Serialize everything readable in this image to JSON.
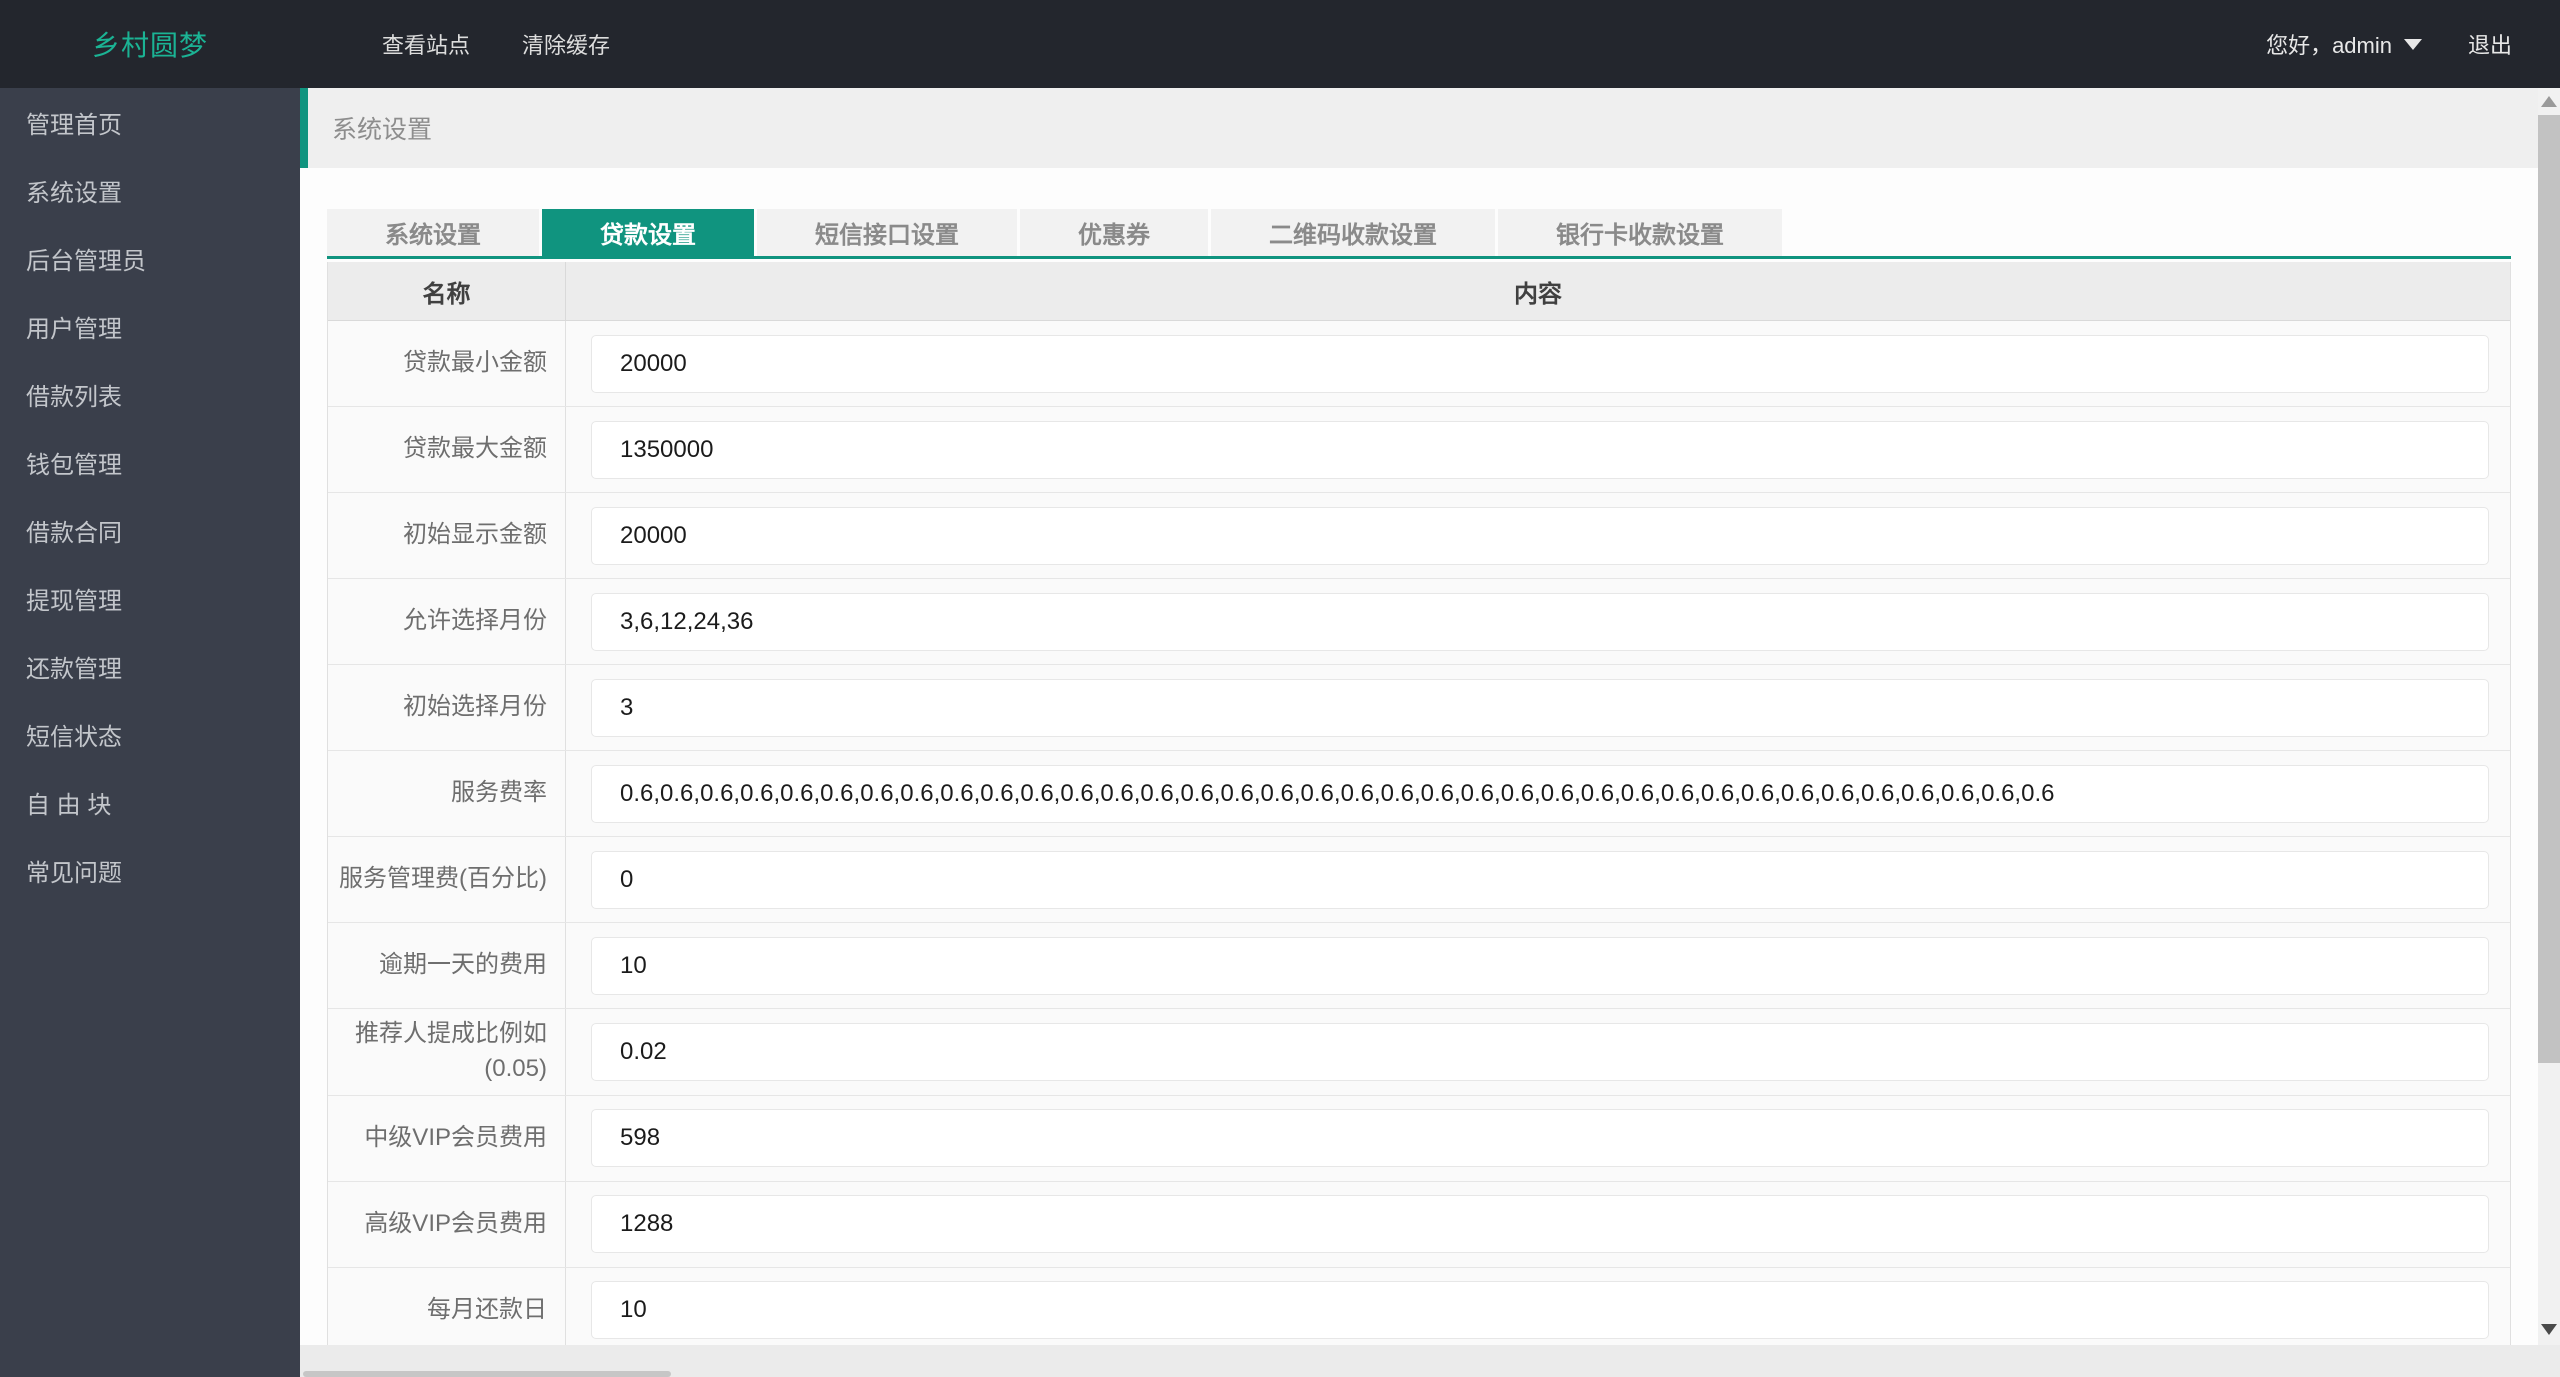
{
  "header": {
    "brand": "乡村圆梦",
    "menu": [
      {
        "label": "查看站点"
      },
      {
        "label": "清除缓存"
      }
    ],
    "greeting": "您好，admin",
    "logout_label": "退出"
  },
  "sidebar": {
    "items": [
      "管理首页",
      "系统设置",
      "后台管理员",
      "用户管理",
      "借款列表",
      "钱包管理",
      "借款合同",
      "提现管理",
      "还款管理",
      "短信状态",
      "自 由 块",
      "常见问题"
    ]
  },
  "breadcrumb": {
    "title": "系统设置"
  },
  "tabs": [
    {
      "label": "系统设置",
      "active": false
    },
    {
      "label": "贷款设置",
      "active": true
    },
    {
      "label": "短信接口设置",
      "active": false
    },
    {
      "label": "优惠券",
      "active": false
    },
    {
      "label": "二维码收款设置",
      "active": false
    },
    {
      "label": "银行卡收款设置",
      "active": false
    }
  ],
  "table": {
    "headers": {
      "name": "名称",
      "content": "内容"
    },
    "rows": [
      {
        "label": "贷款最小金额",
        "value": "20000"
      },
      {
        "label": "贷款最大金额",
        "value": "1350000"
      },
      {
        "label": "初始显示金额",
        "value": "20000"
      },
      {
        "label": "允许选择月份",
        "value": "3,6,12,24,36"
      },
      {
        "label": "初始选择月份",
        "value": "3"
      },
      {
        "label": "服务费率",
        "value": "0.6,0.6,0.6,0.6,0.6,0.6,0.6,0.6,0.6,0.6,0.6,0.6,0.6,0.6,0.6,0.6,0.6,0.6,0.6,0.6,0.6,0.6,0.6,0.6,0.6,0.6,0.6,0.6,0.6,0.6,0.6,0.6,0.6,0.6,0.6,0.6"
      },
      {
        "label": "服务管理费(百分比)",
        "value": "0"
      },
      {
        "label": "逾期一天的费用",
        "value": "10"
      },
      {
        "label": "推荐人提成比例如(0.05)",
        "value": "0.02"
      },
      {
        "label": "中级VIP会员费用",
        "value": "598"
      },
      {
        "label": "高级VIP会员费用",
        "value": "1288"
      },
      {
        "label": "每月还款日",
        "value": "10"
      }
    ]
  },
  "colors": {
    "accent_teal": "#10947f",
    "brand_teal": "#1bb394",
    "header_bg": "#23262d",
    "sidebar_bg": "#3a3f4b",
    "breadcrumb_bg": "#efefef"
  }
}
